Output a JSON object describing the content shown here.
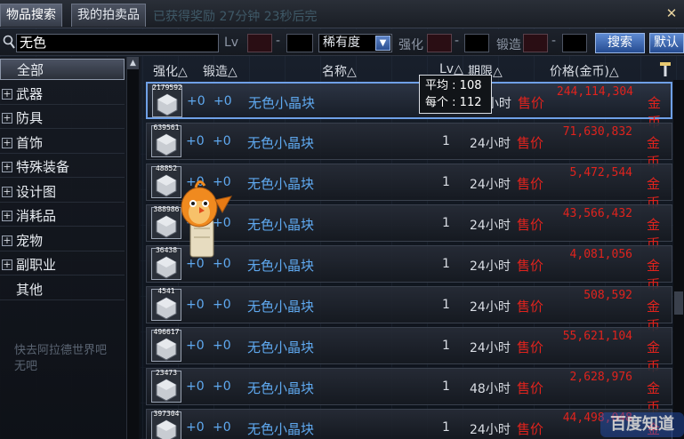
{
  "tabs": [
    {
      "label": "物品搜索",
      "active": true
    },
    {
      "label": "我的拍卖品",
      "active": false
    }
  ],
  "background_tab_text": "已获得奖励 27分钟 23秒后完",
  "search": {
    "value": "无色",
    "level_label": "Lv",
    "rarity_selected": "稀有度",
    "enhance_label": "强化",
    "forge_label": "锻造",
    "search_button": "搜索",
    "extra_button": "默认"
  },
  "sidebar": {
    "items": [
      {
        "label": "全部",
        "expandable": false,
        "selected": true
      },
      {
        "label": "武器",
        "expandable": true,
        "selected": false
      },
      {
        "label": "防具",
        "expandable": true,
        "selected": false
      },
      {
        "label": "首饰",
        "expandable": true,
        "selected": false
      },
      {
        "label": "特殊装备",
        "expandable": true,
        "selected": false
      },
      {
        "label": "设计图",
        "expandable": true,
        "selected": false
      },
      {
        "label": "消耗品",
        "expandable": true,
        "selected": false
      },
      {
        "label": "宠物",
        "expandable": true,
        "selected": false
      },
      {
        "label": "副职业",
        "expandable": true,
        "selected": false
      },
      {
        "label": "其他",
        "expandable": false,
        "selected": false
      }
    ],
    "background_text": "快去阿拉德世界吧\n无吧"
  },
  "columns": {
    "enhance": "强化△",
    "forge": "锻造△",
    "name": "名称△",
    "level": "Lv△",
    "duration": "期限△",
    "price": "价格(金币)△"
  },
  "tooltip": {
    "avg_label": "平均",
    "avg_value": "108",
    "each_label": "每个",
    "each_value": "112"
  },
  "rows": [
    {
      "count": "2179592",
      "enhance": "+0",
      "forge": "+0",
      "name": "无色小晶块",
      "level": "",
      "duration": "24小时",
      "sell": "售价",
      "price": "244,114,304",
      "currency": "金币"
    },
    {
      "count": "639561",
      "enhance": "+0",
      "forge": "+0",
      "name": "无色小晶块",
      "level": "1",
      "duration": "24小时",
      "sell": "售价",
      "price": "71,630,832",
      "currency": "金币"
    },
    {
      "count": "48852",
      "enhance": "+0",
      "forge": "+0",
      "name": "无色小晶块",
      "level": "1",
      "duration": "24小时",
      "sell": "售价",
      "price": "5,472,544",
      "currency": "金币"
    },
    {
      "count": "388986",
      "enhance": "+0",
      "forge": "+0",
      "name": "无色小晶块",
      "level": "1",
      "duration": "24小时",
      "sell": "售价",
      "price": "43,566,432",
      "currency": "金币"
    },
    {
      "count": "36438",
      "enhance": "+0",
      "forge": "+0",
      "name": "无色小晶块",
      "level": "1",
      "duration": "24小时",
      "sell": "售价",
      "price": "4,081,056",
      "currency": "金币"
    },
    {
      "count": "4541",
      "enhance": "+0",
      "forge": "+0",
      "name": "无色小晶块",
      "level": "1",
      "duration": "24小时",
      "sell": "售价",
      "price": "508,592",
      "currency": "金币"
    },
    {
      "count": "496617",
      "enhance": "+0",
      "forge": "+0",
      "name": "无色小晶块",
      "level": "1",
      "duration": "24小时",
      "sell": "售价",
      "price": "55,621,104",
      "currency": "金币"
    },
    {
      "count": "23473",
      "enhance": "+0",
      "forge": "+0",
      "name": "无色小晶块",
      "level": "1",
      "duration": "48小时",
      "sell": "售价",
      "price": "2,628,976",
      "currency": "金币"
    },
    {
      "count": "397304",
      "enhance": "+0",
      "forge": "+0",
      "name": "无色小晶块",
      "level": "1",
      "duration": "24小时",
      "sell": "售价",
      "price": "44,498,048",
      "currency": "金币"
    }
  ],
  "watermark": "百度知道",
  "icons": {
    "close": "close-icon",
    "search": "search-icon",
    "plus": "plus-icon",
    "dropdown": "chevron-down-icon",
    "hammer": "hammer-icon",
    "crystal": "crystal-icon",
    "pet": "pet-bird-icon"
  },
  "colors": {
    "price_red": "#e0231d",
    "name_blue": "#5fa9f0",
    "button_blue": "#3d66b0",
    "selected_border": "#6fa0e6"
  }
}
